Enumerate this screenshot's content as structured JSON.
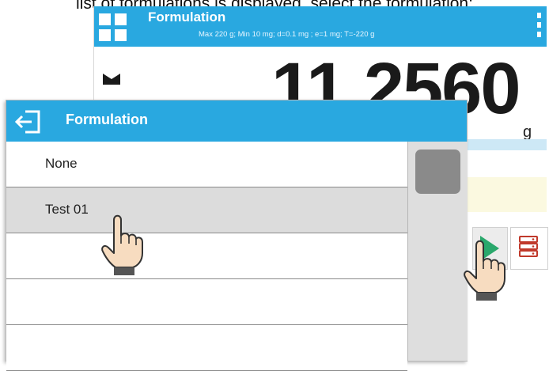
{
  "caption": "list of formulations is displayed, select the formulation:",
  "scale": {
    "title": "Formulation",
    "subtitle": "Max 220 g; Min 10 mg; d=0.1 mg ; e=1 mg; T=-220 g",
    "reading": "11.2560",
    "unit": "g",
    "info_colon": ":",
    "accent_color": "#29a8e0"
  },
  "dialog": {
    "title": "Formulation",
    "items": [
      {
        "label": "None",
        "selected": false
      },
      {
        "label": "Test 01",
        "selected": true
      },
      {
        "label": "",
        "selected": false
      },
      {
        "label": "",
        "selected": false
      },
      {
        "label": "",
        "selected": false
      }
    ]
  },
  "icons": {
    "menu": "grid-icon",
    "more": "kebab-icon",
    "back": "back-icon",
    "start": "play-icon",
    "database": "database-icon",
    "pointer": "hand-pointer-icon"
  }
}
